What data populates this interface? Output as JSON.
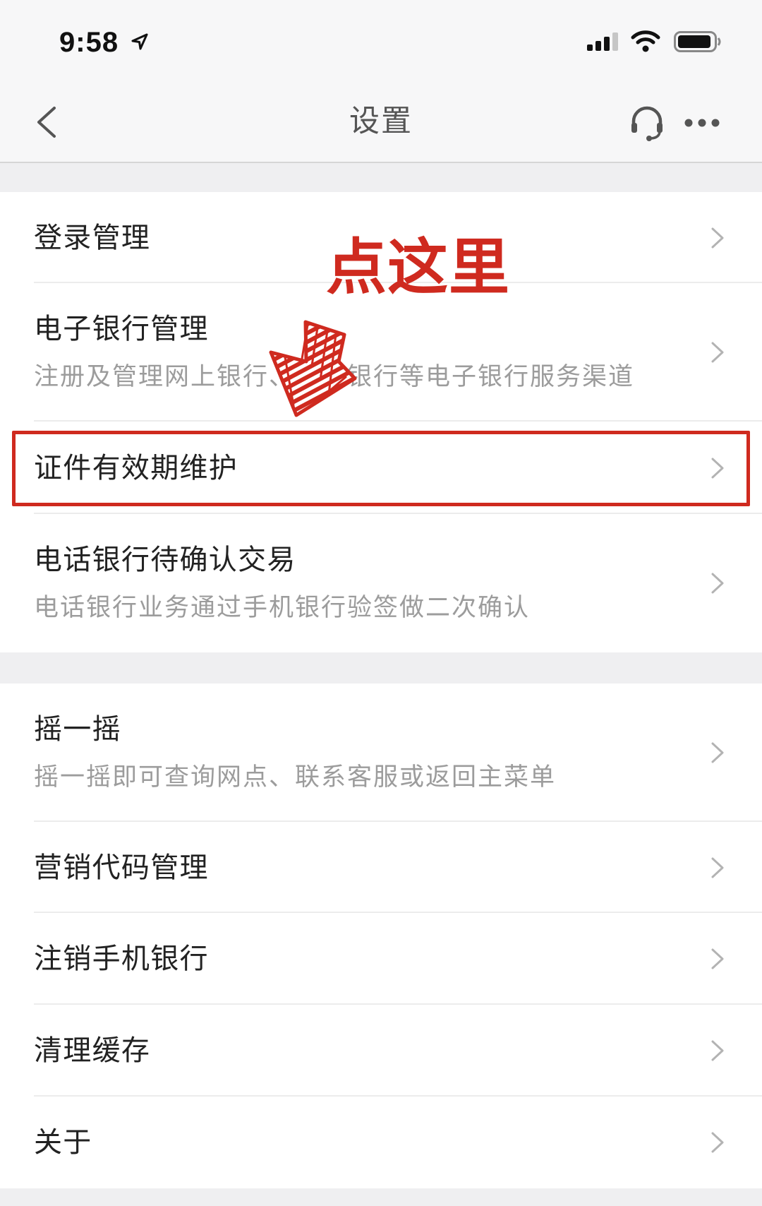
{
  "status_bar": {
    "time": "9:58",
    "icons": [
      "location-arrow-icon",
      "cellular-signal-icon",
      "wifi-icon",
      "battery-icon"
    ]
  },
  "nav_bar": {
    "title": "设置",
    "left_icon": "chevron-left-icon",
    "right_icons": [
      "headset-icon",
      "more-dots-icon"
    ]
  },
  "row_chevron_icon": "chevron-right-icon",
  "sections": [
    {
      "items": [
        {
          "title": "登录管理"
        },
        {
          "title": "电子银行管理",
          "subtitle": "注册及管理网上银行、电话银行等电子银行服务渠道"
        },
        {
          "title": "证件有效期维护",
          "highlighted": true
        },
        {
          "title": "电话银行待确认交易",
          "subtitle": "电话银行业务通过手机银行验签做二次确认"
        }
      ]
    },
    {
      "items": [
        {
          "title": "摇一摇",
          "subtitle": "摇一摇即可查询网点、联系客服或返回主菜单"
        },
        {
          "title": "营销代码管理"
        },
        {
          "title": "注销手机银行"
        },
        {
          "title": "清理缓存"
        },
        {
          "title": "关于"
        }
      ]
    }
  ],
  "annotation": {
    "label": "点这里",
    "pointer_icon": "hand-drawn-arrow-icon"
  },
  "colors": {
    "background": "#efeff1",
    "surface": "#ffffff",
    "text_primary": "#222222",
    "text_secondary": "#9c9c9c",
    "nav_title": "#555555",
    "chevron": "#b3b3b3",
    "annotation_red": "#cf2a1f"
  }
}
